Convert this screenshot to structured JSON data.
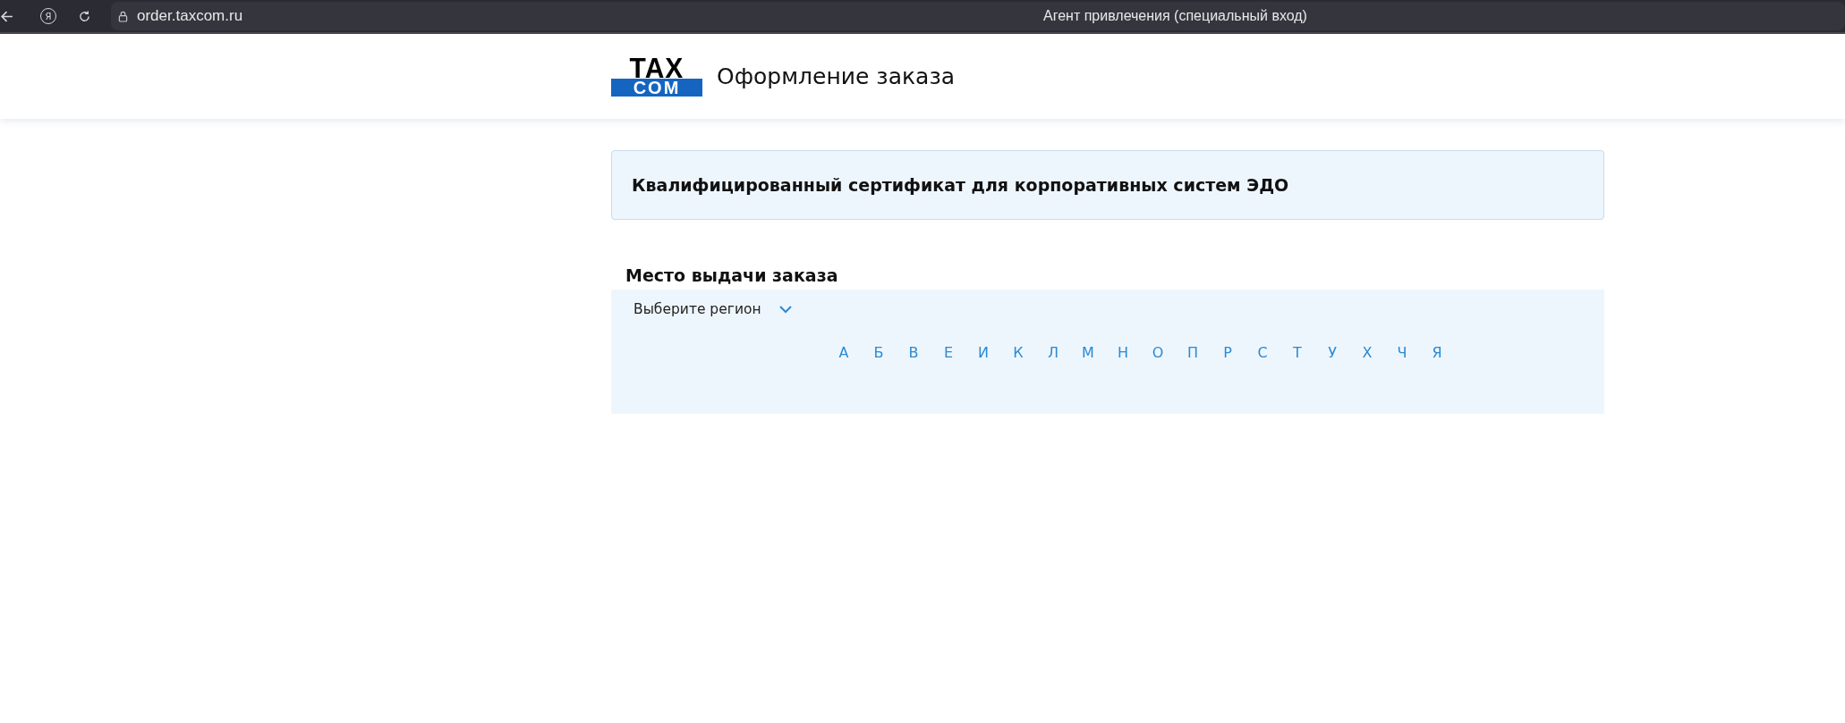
{
  "browser": {
    "yandex_glyph": "Я",
    "url": "order.taxcom.ru",
    "tab_title": "Агент привлечения (специальный вход)"
  },
  "header": {
    "logo_top": "TAX",
    "logo_bottom": "COM",
    "title": "Оформление заказа"
  },
  "product_card": {
    "title": "Квалифицированный сертификат для корпоративных систем ЭДО"
  },
  "pickup": {
    "heading": "Место выдачи заказа",
    "region_select": {
      "placeholder": "Выберите регион"
    },
    "letters": [
      "А",
      "Б",
      "В",
      "Е",
      "И",
      "К",
      "Л",
      "М",
      "Н",
      "О",
      "П",
      "Р",
      "С",
      "Т",
      "У",
      "Х",
      "Ч",
      "Я"
    ]
  }
}
